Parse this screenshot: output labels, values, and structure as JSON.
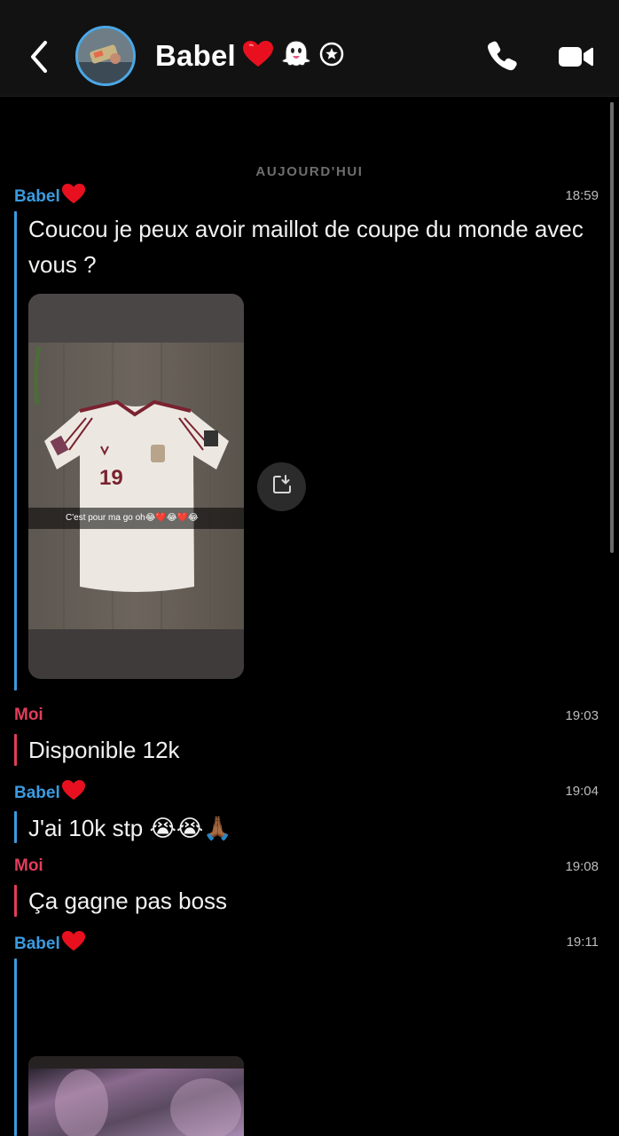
{
  "header": {
    "contact_name": "Babel",
    "icons": [
      "back-chevron-icon",
      "avatar",
      "heart-icon",
      "ghost-icon",
      "star-badge-icon",
      "phone-icon",
      "video-camera-icon"
    ]
  },
  "colors": {
    "background": "#000000",
    "header_bg": "#121212",
    "babel": "#3b9be0",
    "moi": "#e23d5b",
    "avatar_ring": "#4aa8e8"
  },
  "chat": {
    "date_separator": "AUJOURD'HUI",
    "messages": [
      {
        "sender": "Babel",
        "time": "18:59",
        "text": "Coucou je peux avoir maillot de coupe du monde avec vous ?",
        "media_caption": "C'est pour ma go oh😂❤️😂❤️😂"
      },
      {
        "sender": "Moi",
        "time": "19:03",
        "text": "Disponible 12k"
      },
      {
        "sender": "Babel",
        "time": "19:04",
        "text": "J'ai 10k stp 😭😭🙏🏾"
      },
      {
        "sender": "Moi",
        "time": "19:08",
        "text": "Ça gagne pas boss"
      },
      {
        "sender": "Babel",
        "time": "19:11",
        "text": ""
      }
    ]
  }
}
